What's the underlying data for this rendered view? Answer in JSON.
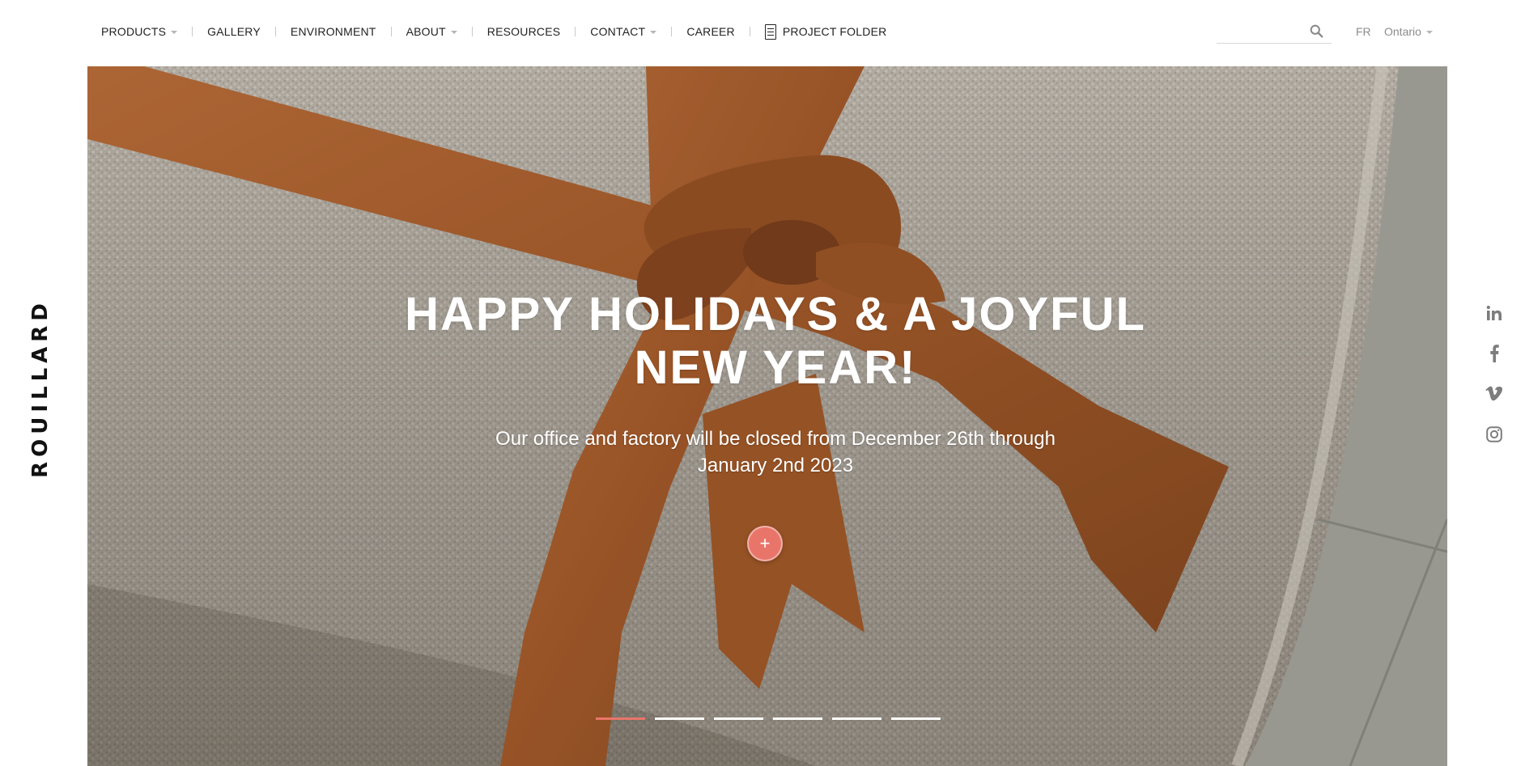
{
  "nav": {
    "items": [
      {
        "label": "PRODUCTS",
        "dropdown": true
      },
      {
        "label": "GALLERY",
        "dropdown": false
      },
      {
        "label": "ENVIRONMENT",
        "dropdown": false
      },
      {
        "label": "ABOUT",
        "dropdown": true
      },
      {
        "label": "RESOURCES",
        "dropdown": false
      },
      {
        "label": "CONTACT",
        "dropdown": true
      },
      {
        "label": "CAREER",
        "dropdown": false
      },
      {
        "label": "PROJECT FOLDER",
        "dropdown": false,
        "icon": "document-icon"
      }
    ]
  },
  "search": {
    "placeholder": "",
    "value": "",
    "icon": "search-icon"
  },
  "lang": {
    "label": "FR"
  },
  "region": {
    "label": "Ontario",
    "dropdown": true
  },
  "brand": {
    "name": "ROUILLARD"
  },
  "hero": {
    "title_line1": "HAPPY HOLIDAYS & A JOYFUL",
    "title_line2": "NEW YEAR!",
    "subtitle_line1": "Our office and factory will be closed from December 26th through",
    "subtitle_line2": "January 2nd 2023",
    "button_label": "+",
    "slides_total": 6,
    "active_slide": 1
  },
  "social": [
    "linkedin-icon",
    "facebook-icon",
    "vimeo-icon",
    "instagram-icon"
  ],
  "colors": {
    "accent": "#e9756a",
    "ribbon": "#b5652d",
    "fabric": "#c6c0b6",
    "text_muted": "#8c8c8c"
  }
}
